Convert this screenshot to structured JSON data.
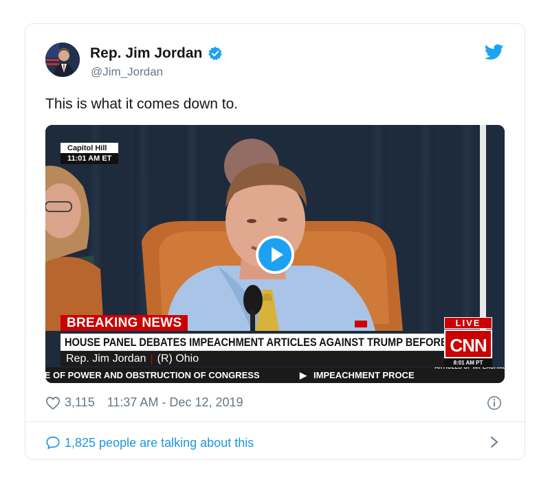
{
  "tweet": {
    "author_name": "Rep. Jim Jordan",
    "handle": "@Jim_Jordan",
    "text": "This is what it comes down to.",
    "likes": "3,115",
    "timestamp": "11:37 AM - Dec 12, 2019",
    "talking": "1,825 people are talking about this"
  },
  "video": {
    "location_line1": "Capitol Hill",
    "location_line2": "11:01 AM ET",
    "breaking": "BREAKING NEWS",
    "headline": "HOUSE PANEL DEBATES IMPEACHMENT ARTICLES AGAINST TRUMP BEFORE VOTE",
    "lower_name": "Rep. Jim Jordan",
    "lower_party": "(R) Ohio",
    "ticker_left": "SE OF POWER AND OBSTRUCTION OF CONGRESS",
    "ticker_right": "IMPEACHMENT PROCE",
    "ticker_small": "ARTICLES OF IMPEACHMENT",
    "live": "LIVE",
    "network": "CNN",
    "network_time": "8:01 AM PT"
  },
  "icons": {
    "verified": "verified-badge-icon",
    "brand": "twitter-bird-icon",
    "play": "play-icon",
    "like": "heart-icon",
    "info": "info-icon",
    "reply": "speech-bubble-icon",
    "more": "chevron-right-icon"
  },
  "colors": {
    "twitter_blue": "#1da1f2",
    "link_blue": "#1b95e0",
    "muted": "#657786",
    "cnn_red": "#cc0000"
  }
}
